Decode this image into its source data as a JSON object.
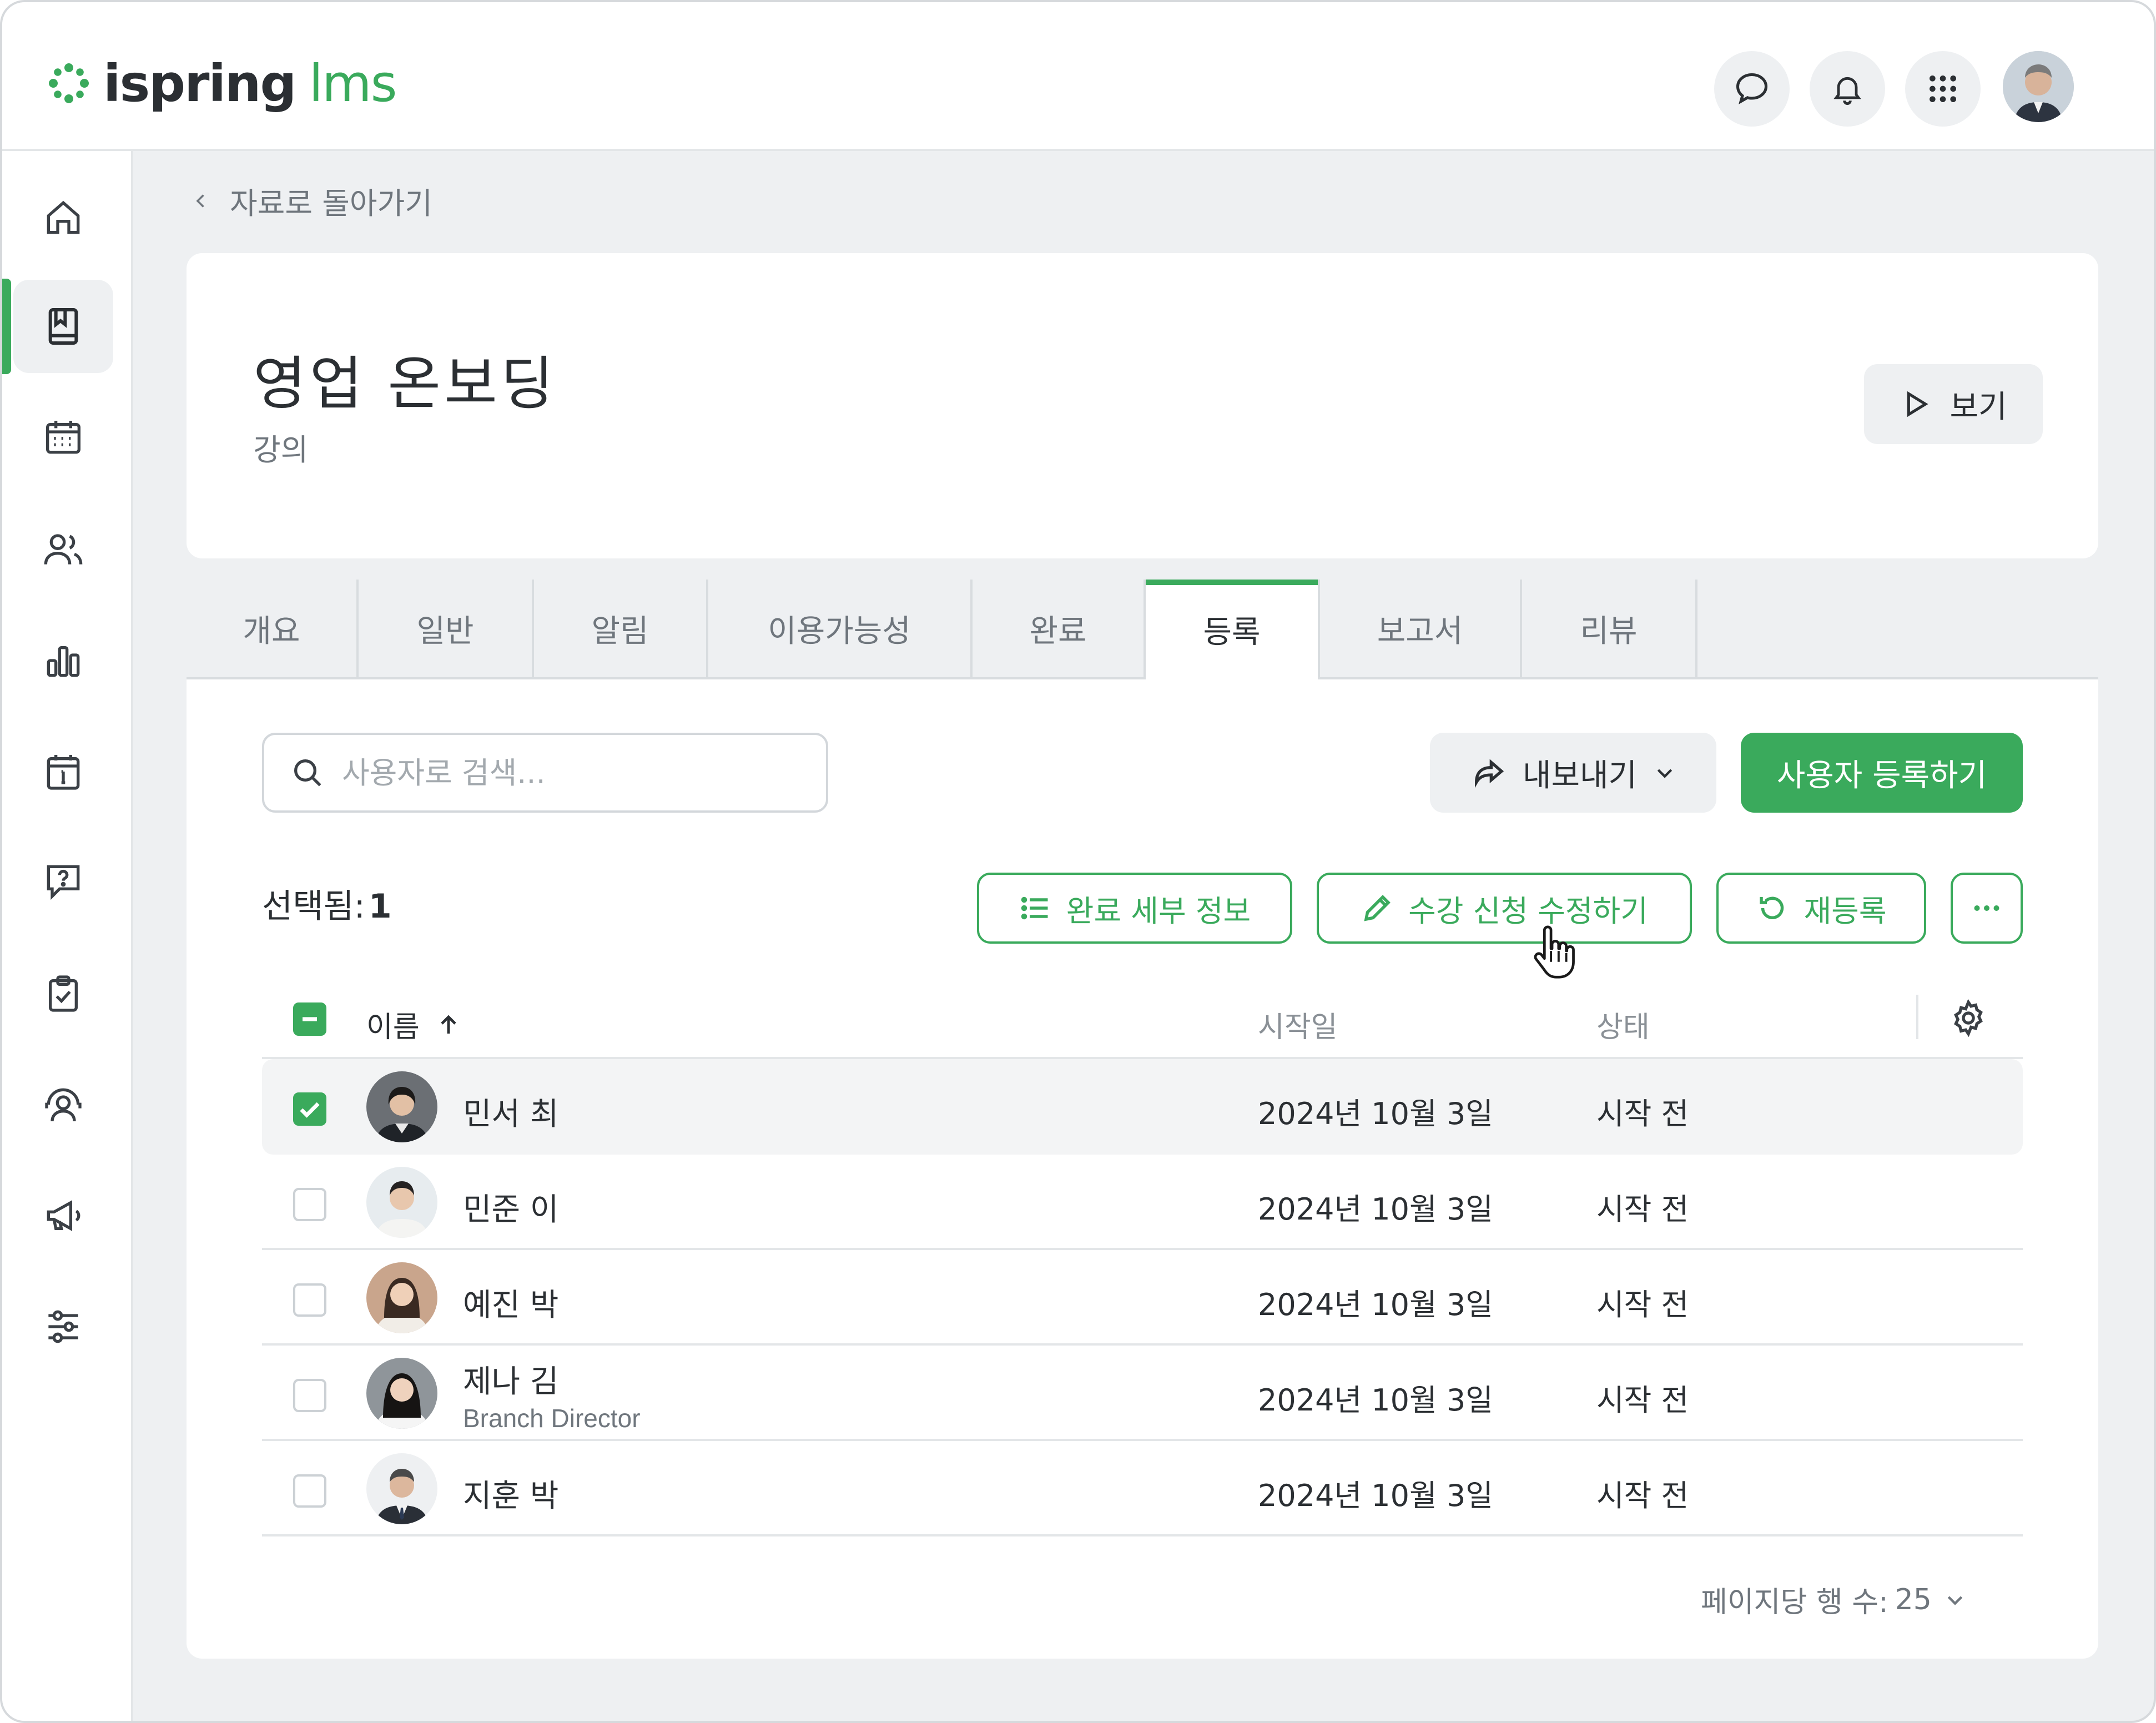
{
  "header": {
    "logo_word": "ispring",
    "logo_accent": "lms",
    "icons": [
      "chat-icon",
      "bell-icon",
      "apps-grid-icon"
    ],
    "brand_color": "#3aaa5c"
  },
  "sidebar": {
    "items": [
      {
        "icon": "home-icon",
        "active": false
      },
      {
        "icon": "book-icon",
        "active": true
      },
      {
        "icon": "calendar-icon",
        "active": false
      },
      {
        "icon": "users-icon",
        "active": false
      },
      {
        "icon": "bar-chart-icon",
        "active": false
      },
      {
        "icon": "info-board-icon",
        "active": false
      },
      {
        "icon": "question-bubble-icon",
        "active": false
      },
      {
        "icon": "clipboard-check-icon",
        "active": false
      },
      {
        "icon": "support-agent-icon",
        "active": false
      },
      {
        "icon": "megaphone-icon",
        "active": false
      },
      {
        "icon": "sliders-icon",
        "active": false
      }
    ]
  },
  "breadcrumb": {
    "back_label": "자료로 돌아가기"
  },
  "course": {
    "title": "영업 온보딩",
    "type": "강의",
    "view_label": "보기"
  },
  "tabs": [
    {
      "label": "개요",
      "active": false
    },
    {
      "label": "일반",
      "active": false
    },
    {
      "label": "알림",
      "active": false
    },
    {
      "label": "이용가능성",
      "active": false
    },
    {
      "label": "완료",
      "active": false
    },
    {
      "label": "등록",
      "active": true
    },
    {
      "label": "보고서",
      "active": false
    },
    {
      "label": "리뷰",
      "active": false
    }
  ],
  "toolbar": {
    "search_placeholder": "사용자로 검색...",
    "export_label": "내보내기",
    "enroll_label": "사용자 등록하기"
  },
  "selection": {
    "label": "선택됨:",
    "count": "1",
    "completion_details_label": "완료 세부 정보",
    "edit_enrollment_label": "수강 신청 수정하기",
    "reenroll_label": "재등록"
  },
  "table": {
    "columns": {
      "name": "이름",
      "start_date": "시작일",
      "status": "상태"
    },
    "rows": [
      {
        "name": "민서 최",
        "subtitle": "",
        "start_date": "2024년 10월 3일",
        "status": "시작 전",
        "checked": true
      },
      {
        "name": "민준 이",
        "subtitle": "",
        "start_date": "2024년 10월 3일",
        "status": "시작 전",
        "checked": false
      },
      {
        "name": "예진 박",
        "subtitle": "",
        "start_date": "2024년 10월 3일",
        "status": "시작 전",
        "checked": false
      },
      {
        "name": "제나 김",
        "subtitle": "Branch Director",
        "start_date": "2024년 10월 3일",
        "status": "시작 전",
        "checked": false
      },
      {
        "name": "지훈 박",
        "subtitle": "",
        "start_date": "2024년 10월 3일",
        "status": "시작 전",
        "checked": false
      }
    ]
  },
  "pagination": {
    "rows_per_page_label": "페이지당 행 수:",
    "rows_per_page_value": "25"
  }
}
